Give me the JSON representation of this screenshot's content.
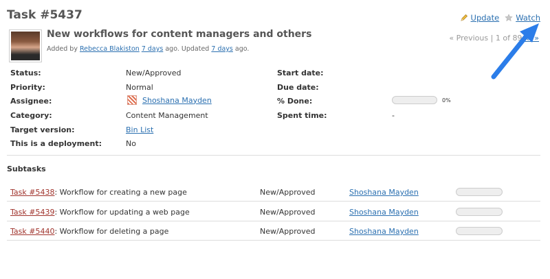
{
  "issue": {
    "title": "Task #5437",
    "subject": "New workflows for content managers and others",
    "author_prefix": "Added by",
    "author_name": "Rebecca Blakiston",
    "added_ago": "7 days",
    "ago_updated": "ago. Updated",
    "updated_ago": "7 days",
    "ago_end": "ago."
  },
  "contextual": {
    "update_label": "Update",
    "watch_label": "Watch",
    "update_icon": "pencil-icon",
    "watch_icon": "star-icon"
  },
  "nav": {
    "previous_label": "« Previous",
    "separator": "|",
    "position": "1 of 89",
    "next_label": "Next »",
    "next_visible": "xt »"
  },
  "attributes": {
    "status_label": "Status:",
    "status_value": "New/Approved",
    "priority_label": "Priority:",
    "priority_value": "Normal",
    "assignee_label": "Assignee:",
    "assignee_value": "Shoshana Mayden",
    "category_label": "Category:",
    "category_value": "Content Management",
    "target_label": "Target version:",
    "target_value": "Bin List",
    "deployment_label": "This is a deployment:",
    "deployment_value": "No",
    "start_label": "Start date:",
    "due_label": "Due date:",
    "done_label": "% Done:",
    "done_percent": 0,
    "done_text": "0%",
    "spent_label": "Spent time:",
    "spent_value": "-"
  },
  "subtasks": {
    "title": "Subtasks",
    "rows": [
      {
        "id": "Task #5438",
        "text": ": Workflow for creating a new page",
        "status": "New/Approved",
        "assignee": "Shoshana Mayden",
        "done": 0
      },
      {
        "id": "Task #5439",
        "text": ": Workflow for updating a web page",
        "status": "New/Approved",
        "assignee": "Shoshana Mayden",
        "done": 0
      },
      {
        "id": "Task #5440",
        "text": ": Workflow for deleting a page",
        "status": "New/Approved",
        "assignee": "Shoshana Mayden",
        "done": 0
      }
    ]
  },
  "colors": {
    "link": "#2a6fb0",
    "task_link": "#a0332c",
    "annotation_arrow": "#2b7de9"
  }
}
